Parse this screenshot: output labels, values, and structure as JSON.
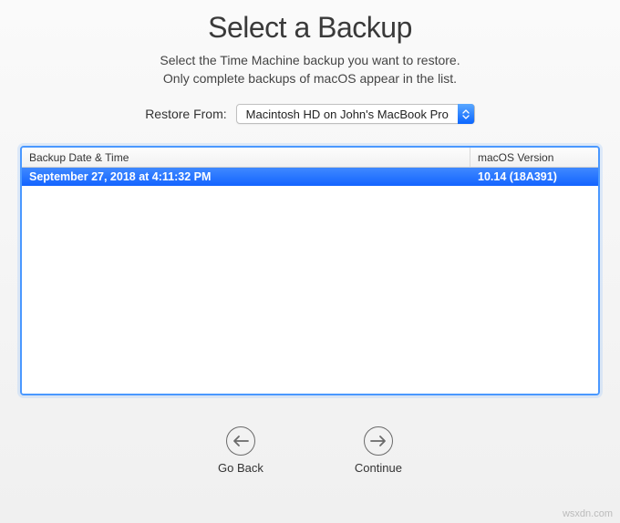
{
  "title": "Select a Backup",
  "subtitle_line1": "Select the Time Machine backup you want to restore.",
  "subtitle_line2": "Only complete backups of macOS appear in the list.",
  "restore": {
    "label": "Restore From:",
    "selected": "Macintosh HD on John's MacBook Pro"
  },
  "table": {
    "headers": {
      "date": "Backup Date & Time",
      "version": "macOS Version"
    },
    "rows": [
      {
        "date": "September 27, 2018 at 4:11:32 PM",
        "version": "10.14 (18A391)",
        "selected": true
      }
    ]
  },
  "nav": {
    "back": "Go Back",
    "continue": "Continue"
  },
  "watermark": "wsxdn.com"
}
